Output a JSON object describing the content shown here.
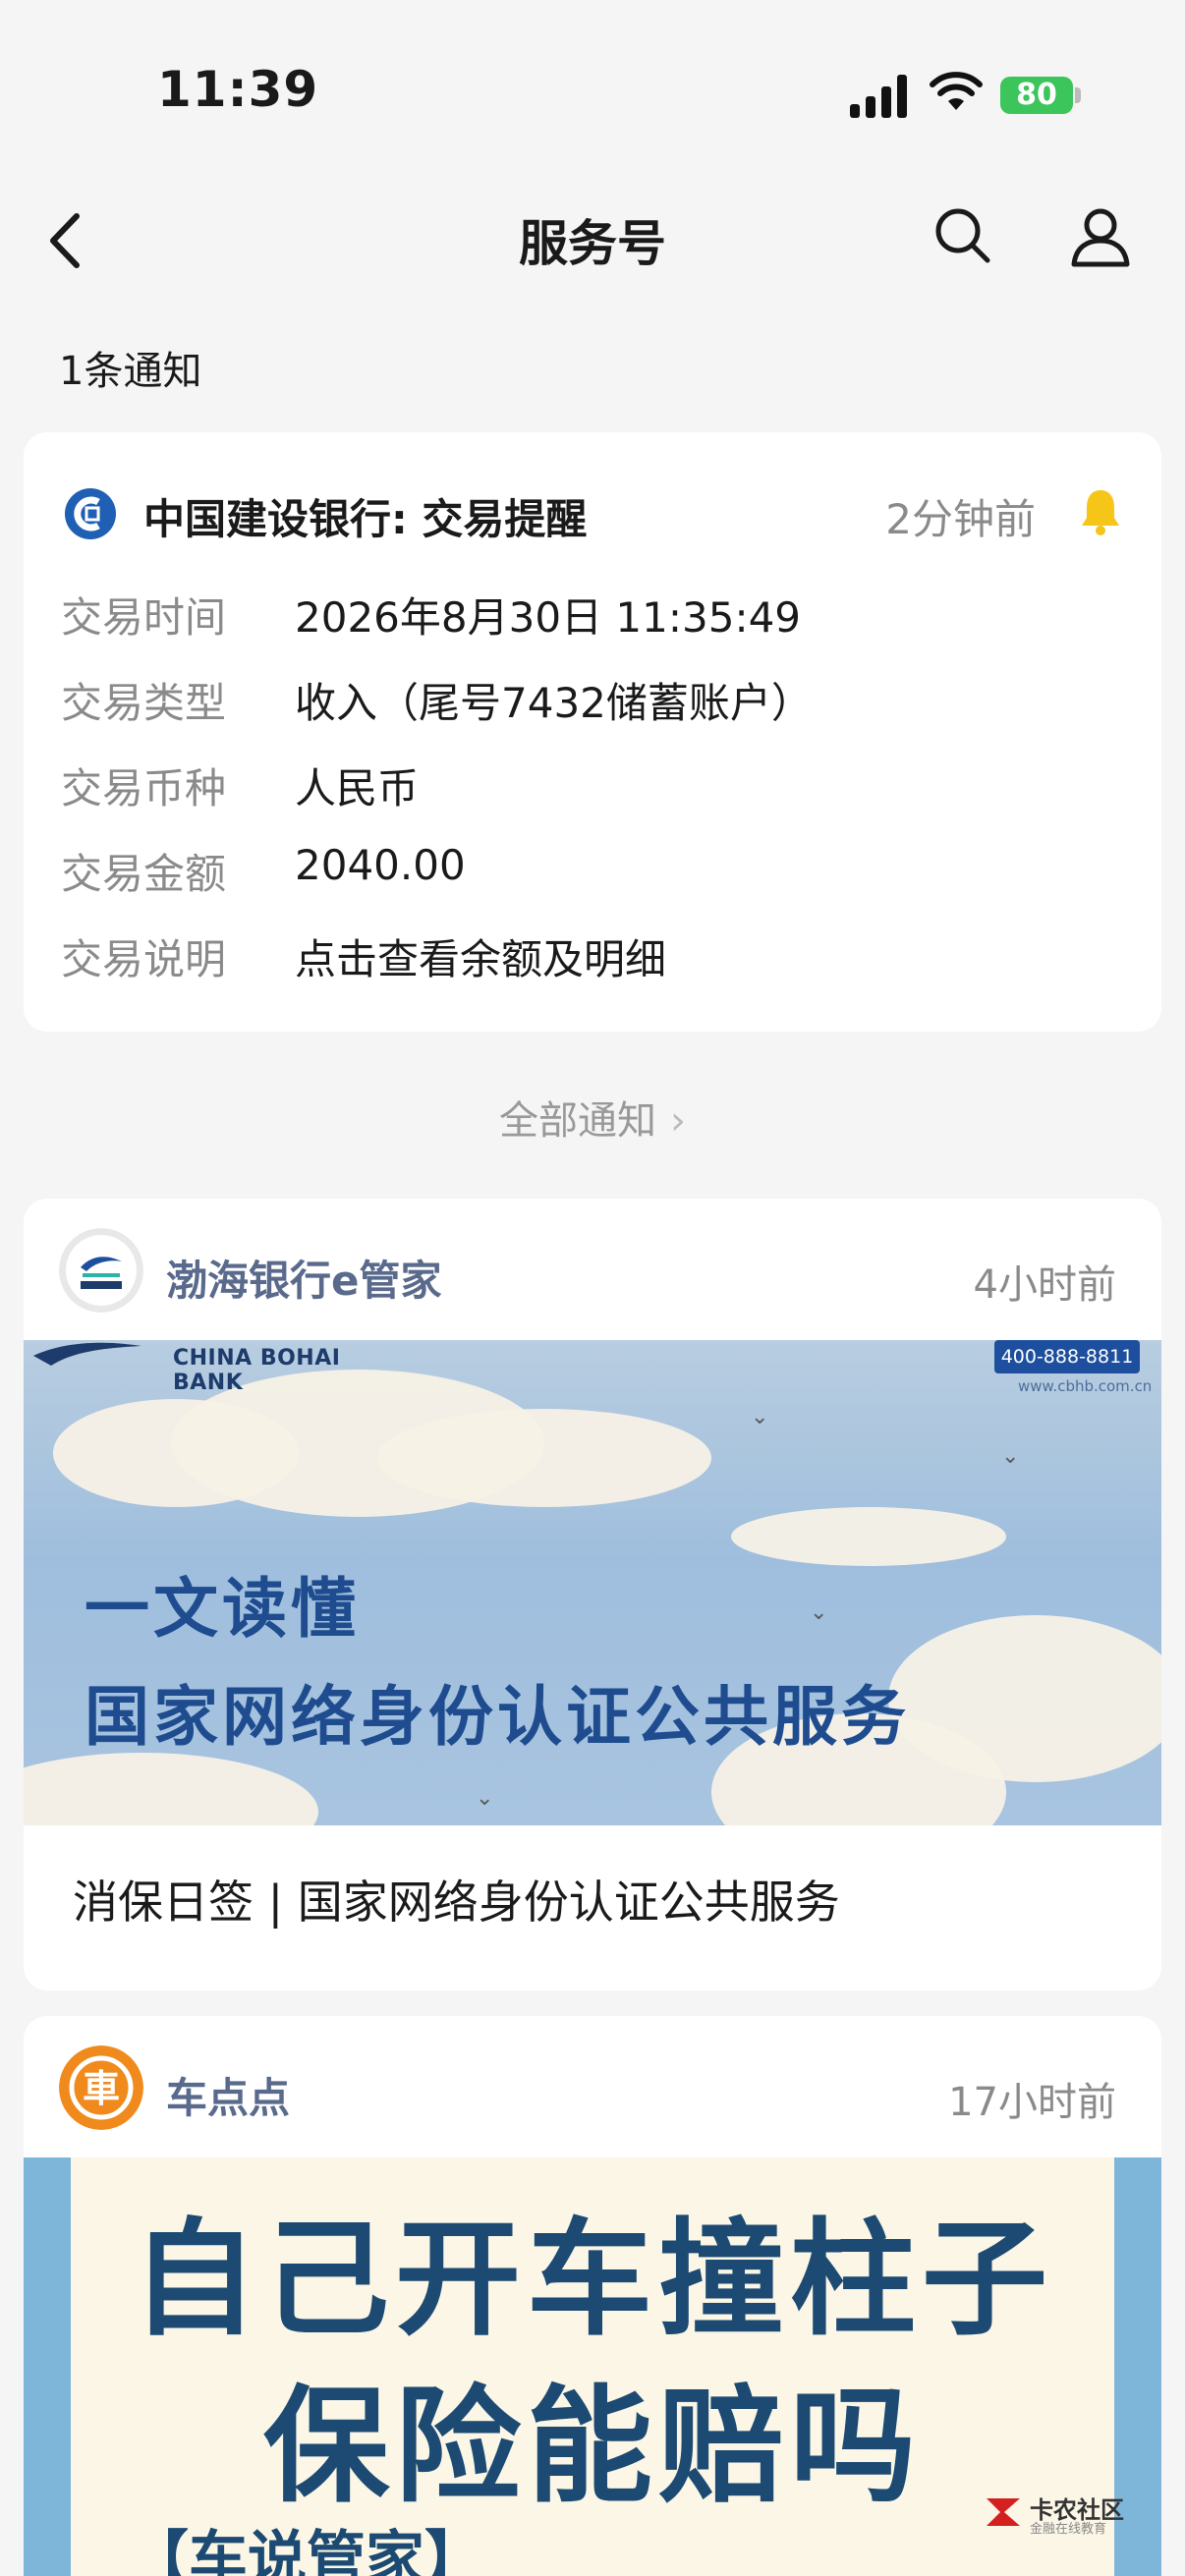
{
  "status_bar": {
    "time": "11:39",
    "battery": "80"
  },
  "nav": {
    "title": "服务号"
  },
  "section_label": "1条通知",
  "ccb": {
    "title": "中国建设银行: 交易提醒",
    "time": "2分钟前",
    "rows": [
      {
        "label": "交易时间",
        "value": "2026年8月30日 11:35:49"
      },
      {
        "label": "交易类型",
        "value": "收入（尾号7432储蓄账户）"
      },
      {
        "label": "交易币种",
        "value": "人民币"
      },
      {
        "label": "交易金额",
        "value": "2040.00"
      },
      {
        "label": "交易说明",
        "value": "点击查看余额及明细"
      }
    ]
  },
  "all_notices": "全部通知",
  "bohai": {
    "name": "渤海银行e管家",
    "time": "4小时前",
    "banner": {
      "bank_en": "CHINA BOHAI BANK",
      "phone": "400-888-8811",
      "web": "www.cbhb.com.cn",
      "line1": "一文读懂",
      "line2": "国家网络身份认证公共服务"
    },
    "article_title": "消保日签 | 国家网络身份认证公共服务"
  },
  "car": {
    "name": "车点点",
    "time": "17小时前",
    "banner": {
      "line1": "自己开车撞柱子",
      "line2": "保险能赔吗",
      "sub": "【车说管家】"
    }
  },
  "watermark": {
    "text": "卡农社区",
    "sub": "金融在线教育"
  },
  "colors": {
    "accent_ccb": "#1f5fb4",
    "bell": "#f5c518",
    "battery": "#3cc55a",
    "car_logo": "#f08a1c"
  }
}
